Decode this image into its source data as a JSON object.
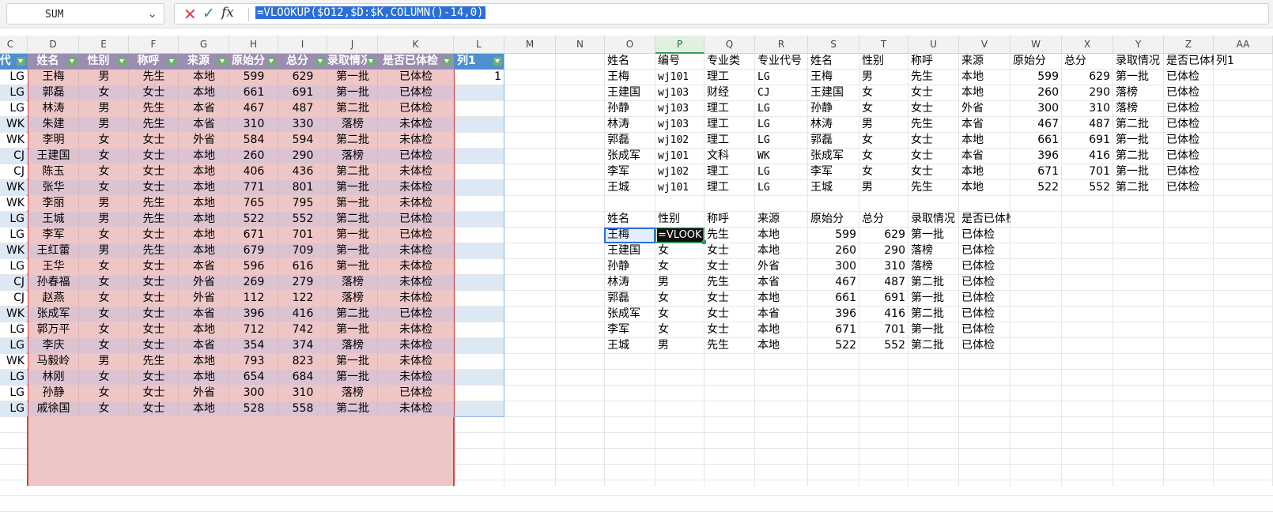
{
  "namebox": "SUM",
  "formula": "=VLOOKUP($O12,$D:$K,COLUMN()-14,0)",
  "columns": [
    "C",
    "D",
    "E",
    "F",
    "G",
    "H",
    "I",
    "J",
    "K",
    "L",
    "M",
    "N",
    "O",
    "P",
    "Q",
    "R",
    "S",
    "T",
    "U",
    "V",
    "W",
    "X",
    "Y",
    "Z",
    "AA"
  ],
  "active_column": "P",
  "table1": {
    "headers": [
      "代",
      "姓名",
      "性别",
      "称呼",
      "来源",
      "原始分",
      "总分",
      "录取情况",
      "是否已体检",
      "列1"
    ],
    "extra_value": "1",
    "rows": [
      [
        "LG",
        "王梅",
        "男",
        "先生",
        "本地",
        "599",
        "629",
        "第一批",
        "已体检"
      ],
      [
        "LG",
        "郭磊",
        "女",
        "女士",
        "本地",
        "661",
        "691",
        "第一批",
        "已体检"
      ],
      [
        "LG",
        "林涛",
        "男",
        "先生",
        "本省",
        "467",
        "487",
        "第二批",
        "已体检"
      ],
      [
        "WK",
        "朱建",
        "男",
        "先生",
        "本省",
        "310",
        "330",
        "落榜",
        "未体检"
      ],
      [
        "WK",
        "李明",
        "女",
        "女士",
        "外省",
        "584",
        "594",
        "第二批",
        "未体检"
      ],
      [
        "CJ",
        "王建国",
        "女",
        "女士",
        "本地",
        "260",
        "290",
        "落榜",
        "已体检"
      ],
      [
        "CJ",
        "陈玉",
        "女",
        "女士",
        "本地",
        "406",
        "436",
        "第二批",
        "未体检"
      ],
      [
        "WK",
        "张华",
        "女",
        "女士",
        "本地",
        "771",
        "801",
        "第一批",
        "未体检"
      ],
      [
        "WK",
        "李丽",
        "男",
        "先生",
        "本地",
        "765",
        "795",
        "第一批",
        "未体检"
      ],
      [
        "LG",
        "王城",
        "男",
        "先生",
        "本地",
        "522",
        "552",
        "第二批",
        "已体检"
      ],
      [
        "LG",
        "李军",
        "女",
        "女士",
        "本地",
        "671",
        "701",
        "第一批",
        "已体检"
      ],
      [
        "WK",
        "王红蕾",
        "男",
        "先生",
        "本地",
        "679",
        "709",
        "第一批",
        "未体检"
      ],
      [
        "LG",
        "王华",
        "女",
        "女士",
        "本省",
        "596",
        "616",
        "第一批",
        "未体检"
      ],
      [
        "CJ",
        "孙春福",
        "女",
        "女士",
        "外省",
        "269",
        "279",
        "落榜",
        "未体检"
      ],
      [
        "CJ",
        "赵燕",
        "女",
        "女士",
        "外省",
        "112",
        "122",
        "落榜",
        "未体检"
      ],
      [
        "WK",
        "张成军",
        "女",
        "女士",
        "本省",
        "396",
        "416",
        "第二批",
        "已体检"
      ],
      [
        "LG",
        "郭万平",
        "女",
        "女士",
        "本地",
        "712",
        "742",
        "第一批",
        "未体检"
      ],
      [
        "LG",
        "李庆",
        "女",
        "女士",
        "本省",
        "354",
        "374",
        "落榜",
        "未体检"
      ],
      [
        "WK",
        "马毅岭",
        "男",
        "先生",
        "本地",
        "793",
        "823",
        "第一批",
        "未体检"
      ],
      [
        "LG",
        "林刚",
        "女",
        "女士",
        "本地",
        "654",
        "684",
        "第一批",
        "未体检"
      ],
      [
        "LG",
        "孙静",
        "女",
        "女士",
        "外省",
        "300",
        "310",
        "落榜",
        "已体检"
      ],
      [
        "LG",
        "戚徐国",
        "女",
        "女士",
        "本地",
        "528",
        "558",
        "第二批",
        "未体检"
      ]
    ]
  },
  "table2": {
    "headers": [
      "姓名",
      "编号",
      "专业类",
      "专业代号",
      "姓名",
      "性别",
      "称呼",
      "来源",
      "原始分",
      "总分",
      "录取情况",
      "是否已体检",
      "列1"
    ],
    "rows": [
      [
        "王梅",
        "wj101",
        "理工",
        "LG",
        "王梅",
        "男",
        "先生",
        "本地",
        "599",
        "629",
        "第一批",
        "已体检"
      ],
      [
        "王建国",
        "wj103",
        "财经",
        "CJ",
        "王建国",
        "女",
        "女士",
        "本地",
        "260",
        "290",
        "落榜",
        "已体检"
      ],
      [
        "孙静",
        "wj103",
        "理工",
        "LG",
        "孙静",
        "女",
        "女士",
        "外省",
        "300",
        "310",
        "落榜",
        "已体检"
      ],
      [
        "林涛",
        "wj103",
        "理工",
        "LG",
        "林涛",
        "男",
        "先生",
        "本省",
        "467",
        "487",
        "第二批",
        "已体检"
      ],
      [
        "郭磊",
        "wj102",
        "理工",
        "LG",
        "郭磊",
        "女",
        "女士",
        "本地",
        "661",
        "691",
        "第一批",
        "已体检"
      ],
      [
        "张成军",
        "wj101",
        "文科",
        "WK",
        "张成军",
        "女",
        "女士",
        "本省",
        "396",
        "416",
        "第二批",
        "已体检"
      ],
      [
        "李军",
        "wj102",
        "理工",
        "LG",
        "李军",
        "女",
        "女士",
        "本地",
        "671",
        "701",
        "第一批",
        "已体检"
      ],
      [
        "王城",
        "wj101",
        "理工",
        "LG",
        "王城",
        "男",
        "先生",
        "本地",
        "522",
        "552",
        "第二批",
        "已体检"
      ]
    ]
  },
  "table3": {
    "headers": [
      "姓名",
      "性别",
      "称呼",
      "来源",
      "原始分",
      "总分",
      "录取情况",
      "是否已体检"
    ],
    "editing_text": "=VLOOK",
    "rows": [
      [
        "王梅",
        "",
        "先生",
        "本地",
        "599",
        "629",
        "第一批",
        "已体检"
      ],
      [
        "王建国",
        "女",
        "女士",
        "本地",
        "260",
        "290",
        "落榜",
        "已体检"
      ],
      [
        "孙静",
        "女",
        "女士",
        "外省",
        "300",
        "310",
        "落榜",
        "已体检"
      ],
      [
        "林涛",
        "男",
        "先生",
        "本省",
        "467",
        "487",
        "第二批",
        "已体检"
      ],
      [
        "郭磊",
        "女",
        "女士",
        "本地",
        "661",
        "691",
        "第一批",
        "已体检"
      ],
      [
        "张成军",
        "女",
        "女士",
        "本省",
        "396",
        "416",
        "第二批",
        "已体检"
      ],
      [
        "李军",
        "女",
        "女士",
        "本地",
        "671",
        "701",
        "第一批",
        "已体检"
      ],
      [
        "王城",
        "男",
        "先生",
        "本地",
        "522",
        "552",
        "第二批",
        "已体检"
      ]
    ]
  },
  "colors": {
    "header_fill": "#9b8db0",
    "band_fill": "#efc6c6",
    "band_border": "#d24444",
    "table_row_stripe": "#dde8f5",
    "selection": "#2b6fd6",
    "active_cell_border": "#3a9a57"
  },
  "icons": [
    "cancel-icon",
    "enter-icon",
    "function-icon",
    "dropdown-icon",
    "filter-icon"
  ]
}
